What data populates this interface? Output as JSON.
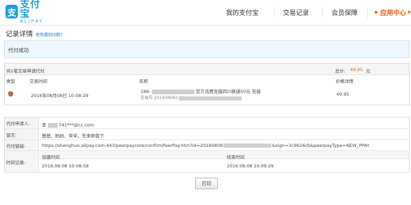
{
  "header": {
    "logo_cn": "支付宝",
    "logo_en": "ALIPAY",
    "nav": {
      "my_alipay": "我的支付宝",
      "trade_records": "交易记录",
      "member_protection": "会员保障",
      "app_center": "应用中心"
    }
  },
  "page": {
    "title": "记录详情",
    "help_link": "使用遇到问题?"
  },
  "banner": {
    "status": "代付成功"
  },
  "transaction": {
    "count_text": "共1笔交易申请代付",
    "total_label": "总计:",
    "total_value": "49.95",
    "total_unit": "元",
    "columns": {
      "type": "类型",
      "time": "交易时间",
      "name": "名称",
      "price": "价格详情"
    },
    "row": {
      "type_icon": "shield-icon",
      "time": "2016年08月08日 10:08:29",
      "name_prefix": "186-",
      "name_suffix": "官方话费充值四川联通50元 充值",
      "order_label": "交易号:",
      "order_no": "201608082",
      "price": "49.95"
    }
  },
  "details": {
    "requester_label": "代付申请人:",
    "requester_prefix": "李",
    "requester_value": "741***@cc.com",
    "message_label": "留言:",
    "message_value": "爸爸、妈妈、爷爷，先来帮我下",
    "link_label": "代付链接:",
    "link_prefix": "https://shenghuo.alipay.com:443/peerpaycore/confirmPeerPay.htm?id=20160808",
    "link_suffix": "&sign=3c9626cb&peerpayType=NEW_PPAY",
    "time_label": "时间记录:",
    "time_columns": {
      "apply": "创建时间",
      "finish": "结束时间"
    },
    "apply_time": "2016.08.08 10:08:58",
    "finish_time": "2016.08.08 10:09:29"
  },
  "actions": {
    "print": "打印"
  },
  "colors": {
    "brand": "#1a9fe0",
    "accent": "#e8620f",
    "banner_bg": "#eef7fd"
  }
}
